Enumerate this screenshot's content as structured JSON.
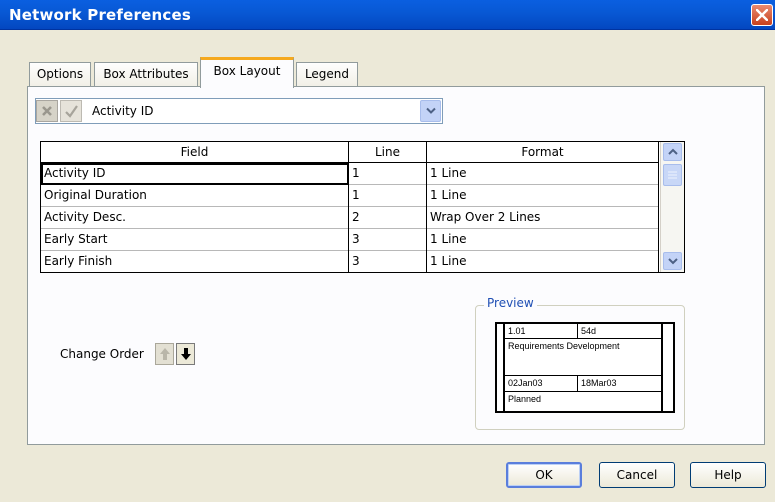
{
  "window": {
    "title": "Network Preferences"
  },
  "tabs": [
    {
      "label": "Options"
    },
    {
      "label": "Box Attributes"
    },
    {
      "label": "Box Layout",
      "active": true
    },
    {
      "label": "Legend"
    }
  ],
  "field_combo": {
    "value": "Activity ID"
  },
  "grid": {
    "columns": [
      "Field",
      "Line",
      "Format"
    ],
    "rows": [
      {
        "field": "Activity ID",
        "line": "1",
        "format": "1 Line"
      },
      {
        "field": "Original Duration",
        "line": "1",
        "format": "1 Line"
      },
      {
        "field": "Activity Desc.",
        "line": "2",
        "format": "Wrap Over 2 Lines"
      },
      {
        "field": "Early Start",
        "line": "3",
        "format": "1 Line"
      },
      {
        "field": "Early Finish",
        "line": "3",
        "format": "1 Line"
      }
    ]
  },
  "change_order": {
    "label": "Change Order"
  },
  "preview": {
    "label": "Preview",
    "id": "1.01",
    "duration": "54d",
    "description": "Requirements Development",
    "start": "02Jan03",
    "finish": "18Mar03",
    "status": "Planned"
  },
  "buttons": {
    "ok": "OK",
    "cancel": "Cancel",
    "help": "Help"
  },
  "colors": {
    "title_bar": "#0858d4",
    "close_button": "#c9401d",
    "active_tab_accent": "#f5a91e",
    "preview_label": "#1f4fb4"
  }
}
